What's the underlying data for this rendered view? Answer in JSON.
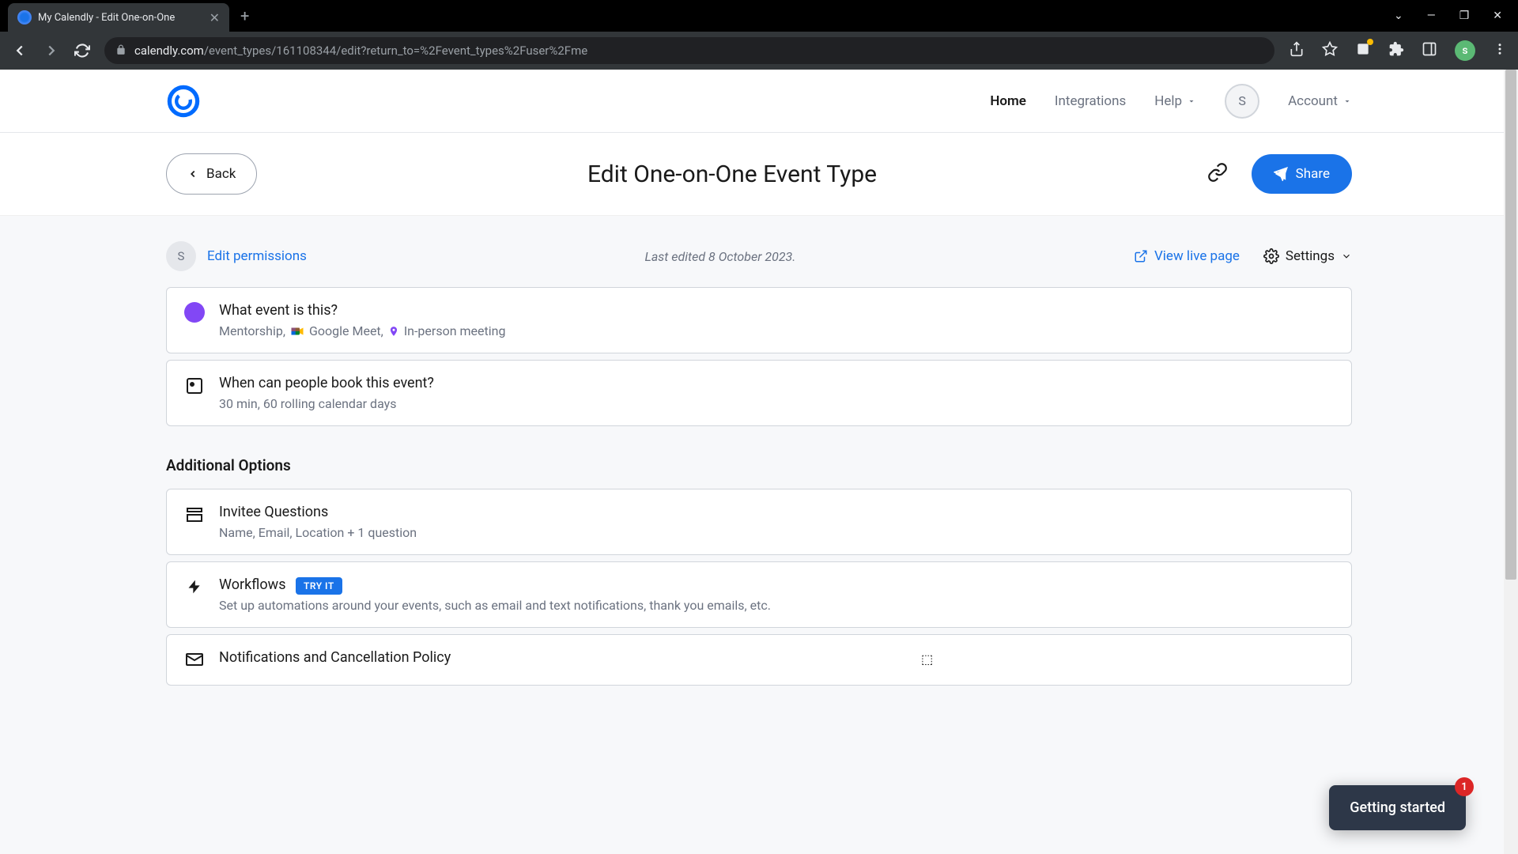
{
  "browser": {
    "tab_title": "My Calendly - Edit One-on-One",
    "url_domain": "calendly.com",
    "url_path": "/event_types/161108344/edit?return_to=%2Fevent_types%2Fuser%2Fme"
  },
  "topnav": {
    "home": "Home",
    "integrations": "Integrations",
    "help": "Help",
    "avatar_initial": "S",
    "account": "Account"
  },
  "header": {
    "back": "Back",
    "title": "Edit One-on-One Event Type",
    "share": "Share"
  },
  "meta": {
    "perm_initial": "S",
    "edit_permissions": "Edit permissions",
    "last_edited": "Last edited 8 October 2023.",
    "view_live": "View live page",
    "settings": "Settings"
  },
  "cards": {
    "what": {
      "title": "What event is this?",
      "sub_prefix": "Mentorship,",
      "sub_gmeet": "Google Meet,",
      "sub_inperson": "In-person meeting"
    },
    "when": {
      "title": "When can people book this event?",
      "sub": "30 min, 60 rolling calendar days"
    }
  },
  "additional": {
    "heading": "Additional Options",
    "invitee": {
      "title": "Invitee Questions",
      "sub": "Name, Email, Location + 1 question"
    },
    "workflows": {
      "title": "Workflows",
      "try": "TRY IT",
      "sub": "Set up automations around your events, such as email and text notifications, thank you emails, etc."
    },
    "notifications": {
      "title": "Notifications and Cancellation Policy"
    }
  },
  "getting_started": {
    "label": "Getting started",
    "count": "1"
  }
}
